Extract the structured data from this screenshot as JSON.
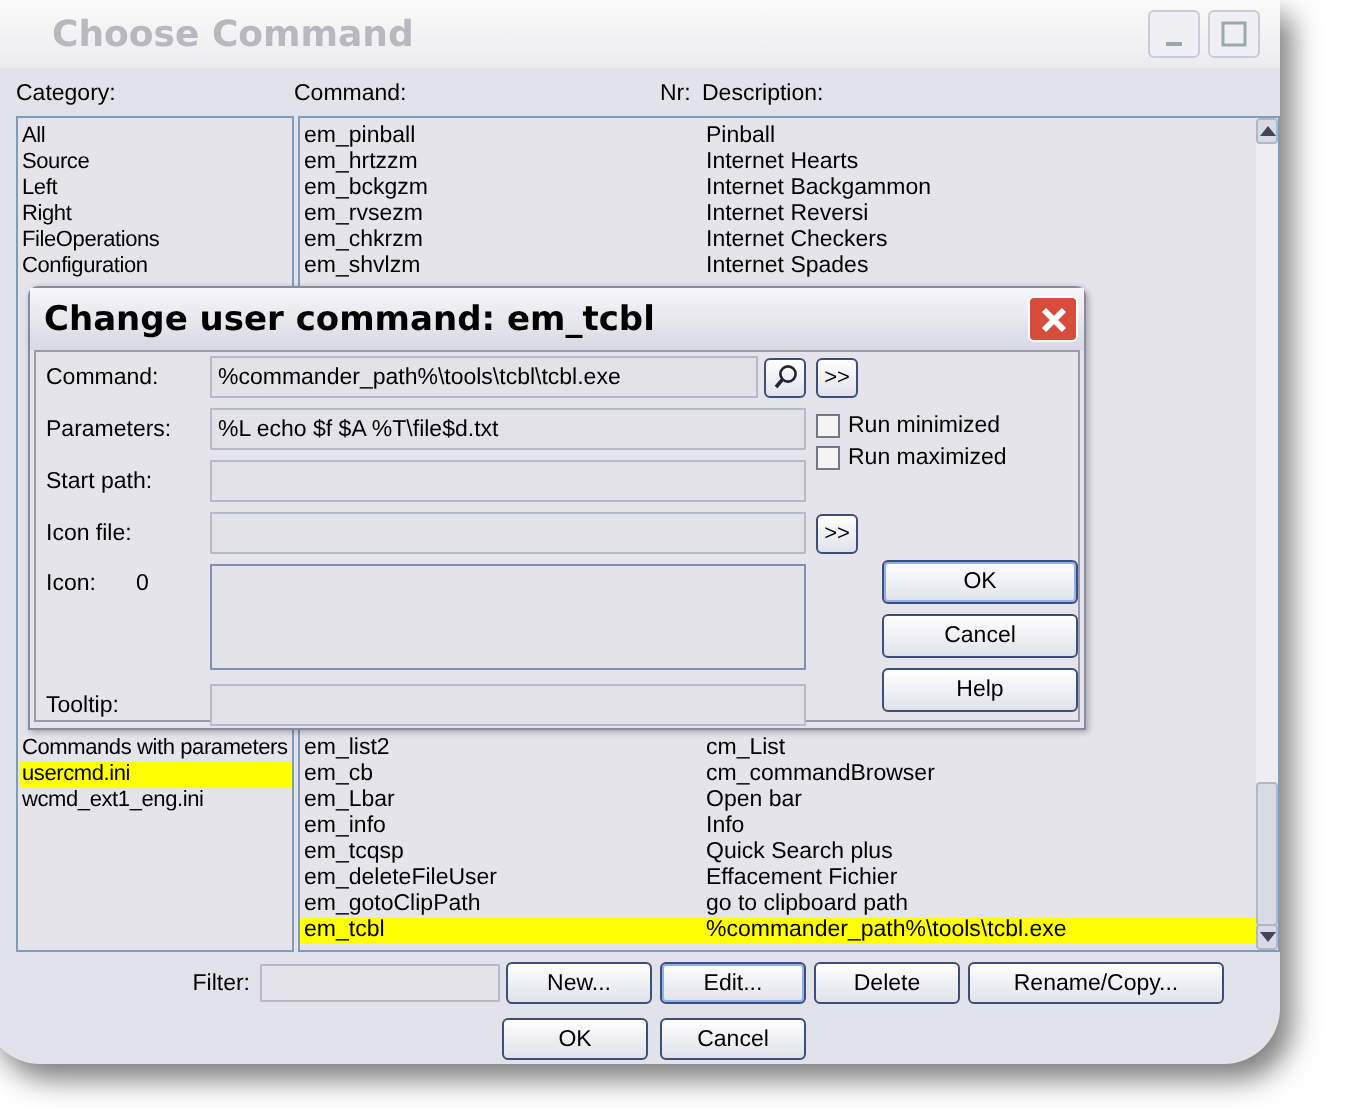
{
  "window": {
    "title": "Choose Command"
  },
  "headers": {
    "category": "Category:",
    "command": "Command:",
    "nr": "Nr:",
    "description": "Description:"
  },
  "categories_above": [
    {
      "label": "All",
      "selected": false
    },
    {
      "label": "Source",
      "selected": false
    },
    {
      "label": "Left",
      "selected": false
    },
    {
      "label": "Right",
      "selected": false
    },
    {
      "label": "FileOperations",
      "selected": false
    },
    {
      "label": "Configuration",
      "selected": false
    }
  ],
  "categories_below": [
    {
      "label": "Commands with parameters",
      "selected": false
    },
    {
      "label": "usercmd.ini",
      "selected": true
    },
    {
      "label": "wcmd_ext1_eng.ini",
      "selected": false
    }
  ],
  "commands_above": [
    {
      "command": "em_pinball",
      "description": "Pinball",
      "selected": false
    },
    {
      "command": "em_hrtzzm",
      "description": "Internet Hearts",
      "selected": false
    },
    {
      "command": "em_bckgzm",
      "description": "Internet Backgammon",
      "selected": false
    },
    {
      "command": "em_rvsezm",
      "description": "Internet Reversi",
      "selected": false
    },
    {
      "command": "em_chkrzm",
      "description": "Internet Checkers",
      "selected": false
    },
    {
      "command": "em_shvlzm",
      "description": "Internet Spades",
      "selected": false
    }
  ],
  "commands_below": [
    {
      "command": "em_list2",
      "description": "cm_List",
      "selected": false
    },
    {
      "command": "em_cb",
      "description": "cm_commandBrowser",
      "selected": false
    },
    {
      "command": "em_Lbar",
      "description": "Open bar",
      "selected": false
    },
    {
      "command": "em_info",
      "description": "Info",
      "selected": false
    },
    {
      "command": "em_tcqsp",
      "description": "Quick Search plus",
      "selected": false
    },
    {
      "command": "em_deleteFileUser",
      "description": "Effacement Fichier",
      "selected": false
    },
    {
      "command": "em_gotoClipPath",
      "description": "go to clipboard path",
      "selected": false
    },
    {
      "command": "em_tcbl",
      "description": "%commander_path%\\tools\\tcbl.exe",
      "selected": true
    }
  ],
  "filter": {
    "label": "Filter:"
  },
  "actions": [
    "New...",
    "Edit...",
    "Delete",
    "Rename/Copy..."
  ],
  "buttons": [
    "OK",
    "Cancel"
  ],
  "dialog": {
    "title": "Change user command: em_tcbl",
    "command": {
      "label": "Command:",
      "value": "%commander_path%\\tools\\tcbl\\tcbl.exe",
      "more": ">>"
    },
    "parameters": {
      "label": "Parameters:",
      "value": "%L echo $f $A %T\\file$d.txt"
    },
    "start_path": {
      "label": "Start path:"
    },
    "icon_file": {
      "label": "Icon file:",
      "more": ">>"
    },
    "icon": {
      "label": "Icon:",
      "index": "0"
    },
    "tooltip": {
      "label": "Tooltip:"
    },
    "options": [
      {
        "label": "Run minimized",
        "checked": false
      },
      {
        "label": "Run maximized",
        "checked": false
      }
    ],
    "buttons": [
      "OK",
      "Cancel",
      "Help"
    ]
  }
}
